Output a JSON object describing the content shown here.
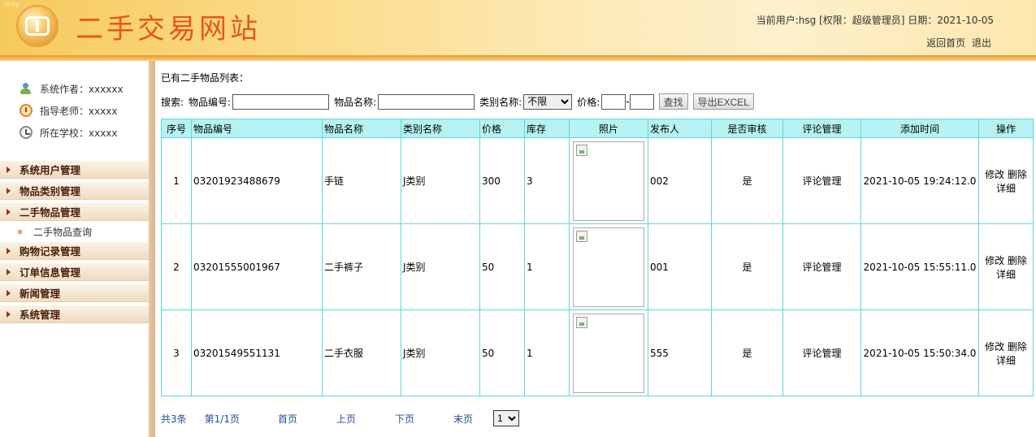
{
  "header": {
    "watermark": "way...",
    "site_title": "二手交易网站",
    "user_info": "当前用户:hsg [权限：超级管理员] 日期：2021-10-05",
    "links": [
      "返回首页",
      "退出"
    ]
  },
  "sidebar": {
    "info": [
      {
        "label": "系统作者：xxxxxx",
        "icon": "user-icon"
      },
      {
        "label": "指导老师：xxxxx",
        "icon": "alarm-clock-icon"
      },
      {
        "label": "所在学校：xxxxx",
        "icon": "clock-icon"
      }
    ],
    "menu": [
      {
        "label": "系统用户管理"
      },
      {
        "label": "物品类别管理"
      },
      {
        "label": "二手物品管理",
        "subitems": [
          "二手物品查询"
        ]
      },
      {
        "label": "购物记录管理"
      },
      {
        "label": "订单信息管理"
      },
      {
        "label": "新闻管理"
      },
      {
        "label": "系统管理"
      }
    ]
  },
  "main": {
    "list_title": "已有二手物品列表：",
    "search": {
      "prefix": "搜索:",
      "code_label": "物品编号:",
      "name_label": "物品名称:",
      "category_label": "类别名称:",
      "category_selected": "不限",
      "price_label": "价格:",
      "price_sep": "-",
      "find_button": "查找",
      "export_button": "导出EXCEL"
    },
    "table": {
      "headers": [
        "序号",
        "物品编号",
        "物品名称",
        "类别名称",
        "价格",
        "库存",
        "照片",
        "发布人",
        "是否审核",
        "评论管理",
        "添加时间",
        "操作"
      ],
      "rows": [
        {
          "no": "1",
          "code": "03201923488679",
          "name": "手链",
          "category": "J类别",
          "price": "300",
          "stock": "3",
          "publisher": "002",
          "audited": "是",
          "comment": "评论管理",
          "time": "2021-10-05 19:24:12.0",
          "edit": "修改",
          "delete": "删除",
          "detail": "详细"
        },
        {
          "no": "2",
          "code": "03201555001967",
          "name": "二手裤子",
          "category": "J类别",
          "price": "50",
          "stock": "1",
          "publisher": "001",
          "audited": "是",
          "comment": "评论管理",
          "time": "2021-10-05 15:55:11.0",
          "edit": "修改",
          "delete": "删除",
          "detail": "详细"
        },
        {
          "no": "3",
          "code": "03201549551131",
          "name": "二手衣服",
          "category": "J类别",
          "price": "50",
          "stock": "1",
          "publisher": "555",
          "audited": "是",
          "comment": "评论管理",
          "time": "2021-10-05 15:50:34.0",
          "edit": "修改",
          "delete": "删除",
          "detail": "详细"
        }
      ]
    },
    "pager": {
      "total": "共3条",
      "page_info": "第1/1页",
      "first": "首页",
      "prev": "上页",
      "next": "下页",
      "last": "末页",
      "page_select": "1"
    }
  },
  "colors": {
    "title": "#e8561b",
    "table_header_bg": "#b7f2f2",
    "table_border": "#5fd7d7",
    "menu_text": "#4a1d0a",
    "pager_link": "#1d4f9c"
  }
}
